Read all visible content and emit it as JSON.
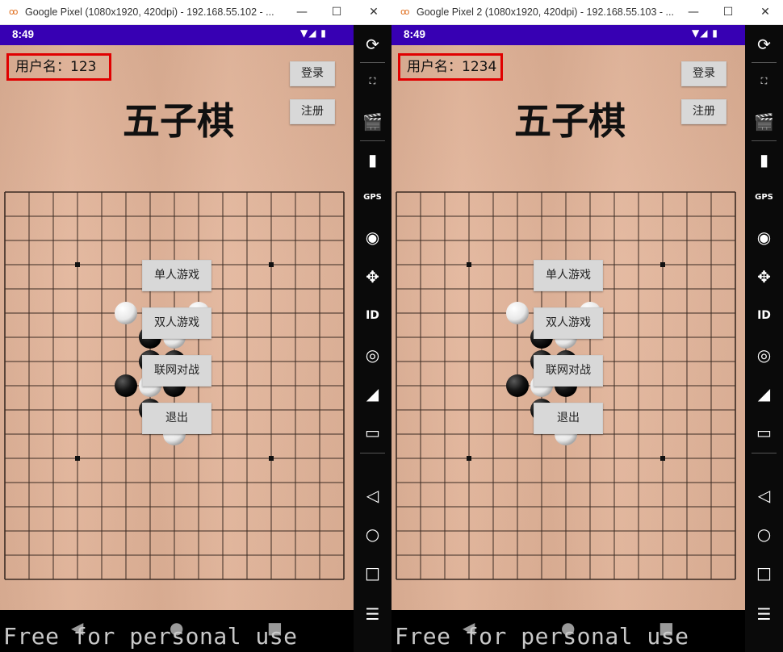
{
  "windows": [
    {
      "title": "Google Pixel (1080x1920, 420dpi) - 192.168.55.102 - ...",
      "status_time": "8:49",
      "username_text": "用户名：123",
      "login_label": "登录",
      "register_label": "注册",
      "game_title": "五子棋",
      "menu": [
        "单人游戏",
        "双人游戏",
        "联网对战",
        "退出"
      ],
      "watermark": "Free for personal use"
    },
    {
      "title": "Google Pixel 2 (1080x1920, 420dpi) - 192.168.55.103 - ...",
      "status_time": "8:49",
      "username_text": "用户名：1234",
      "login_label": "登录",
      "register_label": "注册",
      "game_title": "五子棋",
      "menu": [
        "单人游戏",
        "双人游戏",
        "联网对战",
        "退出"
      ],
      "watermark": "Free for personal use"
    }
  ],
  "board": {
    "columns": 15,
    "rows": 17,
    "star_points": [
      [
        3,
        3
      ],
      [
        11,
        3
      ],
      [
        3,
        11
      ],
      [
        11,
        11
      ]
    ],
    "stones": [
      {
        "col": 5,
        "row": 5,
        "color": "white"
      },
      {
        "col": 8,
        "row": 5,
        "color": "white"
      },
      {
        "col": 6,
        "row": 6,
        "color": "black"
      },
      {
        "col": 7,
        "row": 6,
        "color": "white"
      },
      {
        "col": 6,
        "row": 7,
        "color": "black"
      },
      {
        "col": 7,
        "row": 7,
        "color": "black"
      },
      {
        "col": 5,
        "row": 8,
        "color": "black"
      },
      {
        "col": 6,
        "row": 8,
        "color": "white"
      },
      {
        "col": 7,
        "row": 8,
        "color": "black"
      },
      {
        "col": 6,
        "row": 9,
        "color": "black"
      },
      {
        "col": 7,
        "row": 10,
        "color": "white"
      }
    ]
  },
  "colors": {
    "status_bar": "#3700b3",
    "highlight_box": "#e00000",
    "board_line": "#3a2a22",
    "wood": "#e0b397"
  },
  "toolbar_icons": [
    "rotate-icon",
    "one-to-one-icon",
    "screen-record-icon",
    "battery-icon",
    "gps-icon",
    "camera-icon",
    "dpad-icon",
    "id-icon",
    "media-icon",
    "cast-icon",
    "message-icon",
    "back-icon",
    "home-icon",
    "overview-icon",
    "menu-icon",
    "more-icon"
  ]
}
